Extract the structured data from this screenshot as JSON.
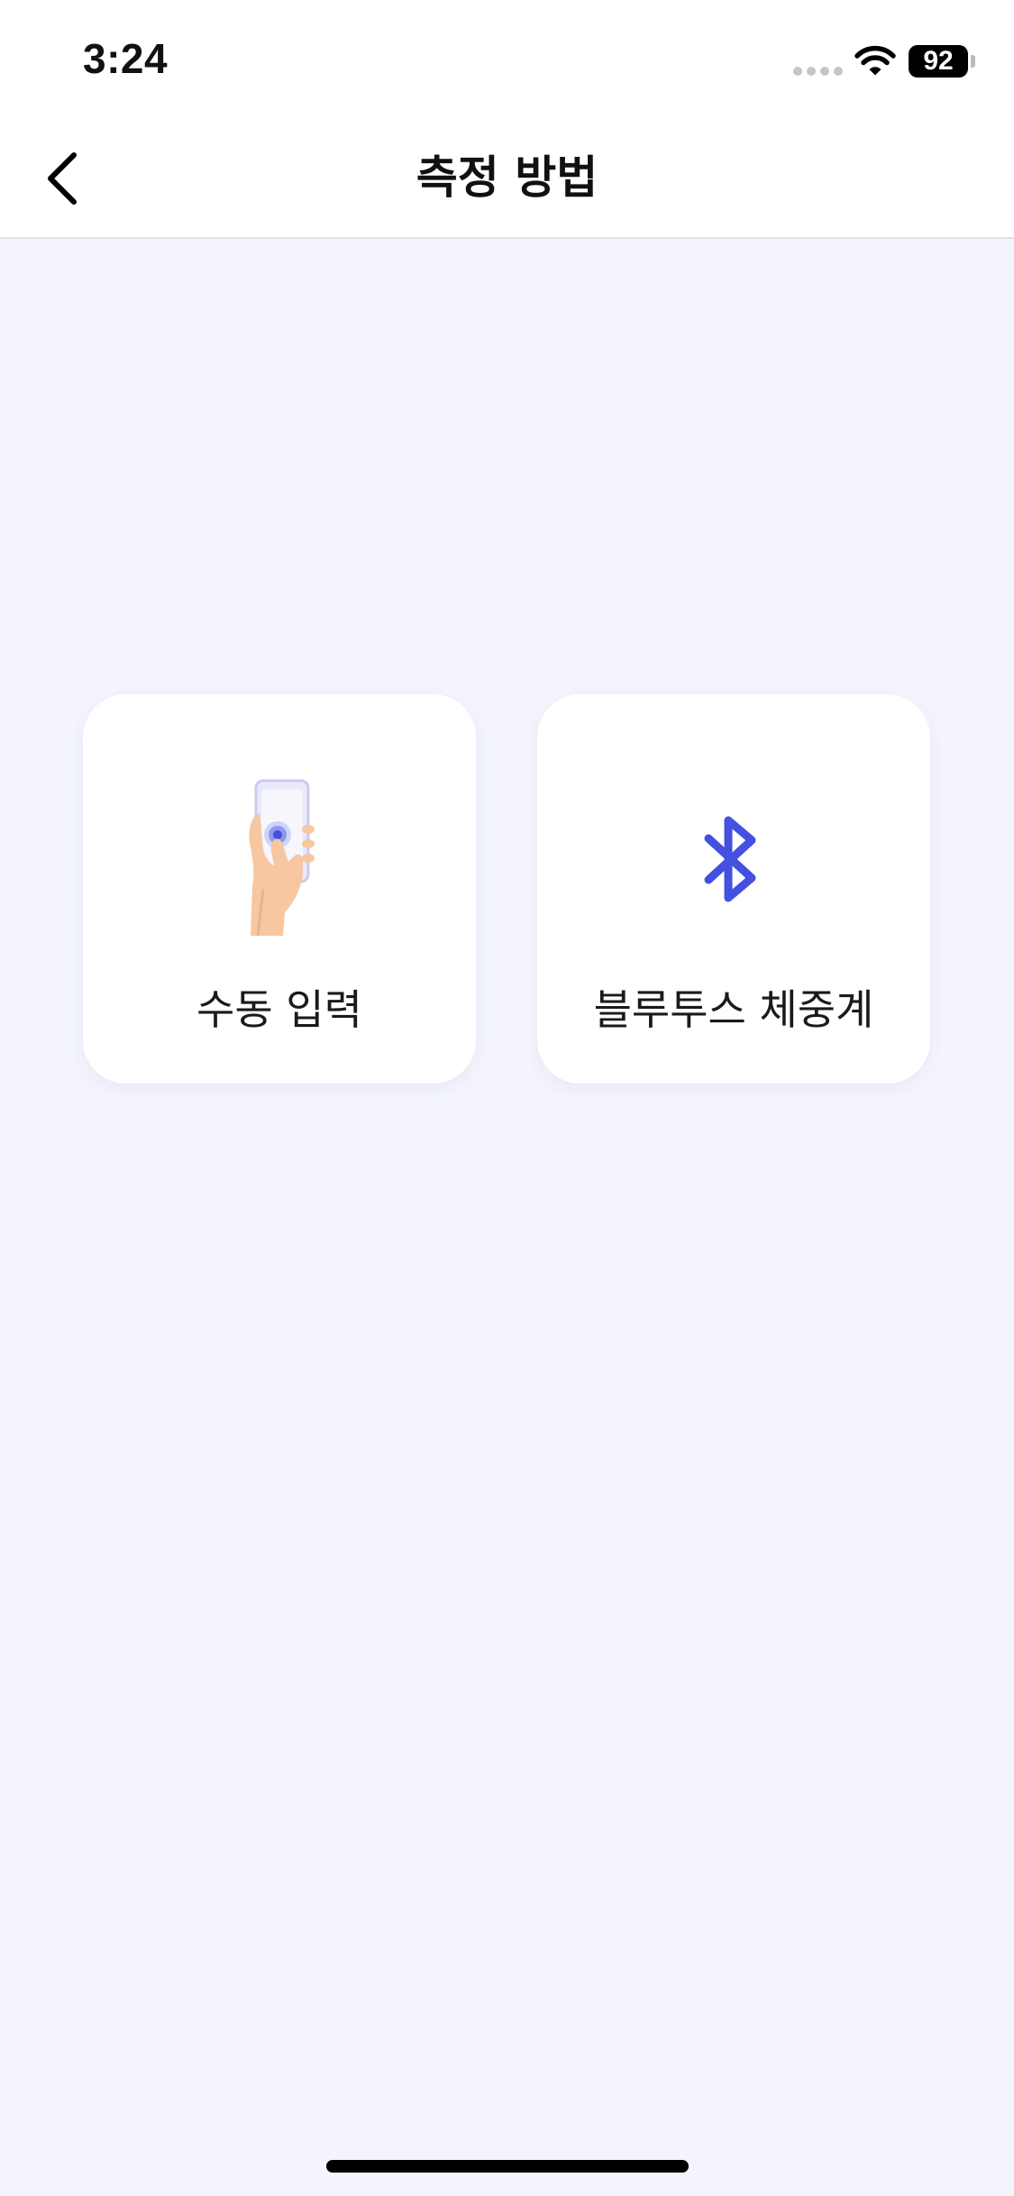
{
  "status_bar": {
    "time": "3:24",
    "battery": "92"
  },
  "header": {
    "title": "측정 방법",
    "back_icon": "chevron-left-icon"
  },
  "options": [
    {
      "label": "수동 입력",
      "icon": "hand-phone-tap-icon"
    },
    {
      "label": "블루투스 체중계",
      "icon": "bluetooth-icon"
    }
  ],
  "colors": {
    "background": "#f3f4fc",
    "card": "#ffffff",
    "accent": "#4450e0",
    "skin": "#f6c7a0"
  }
}
